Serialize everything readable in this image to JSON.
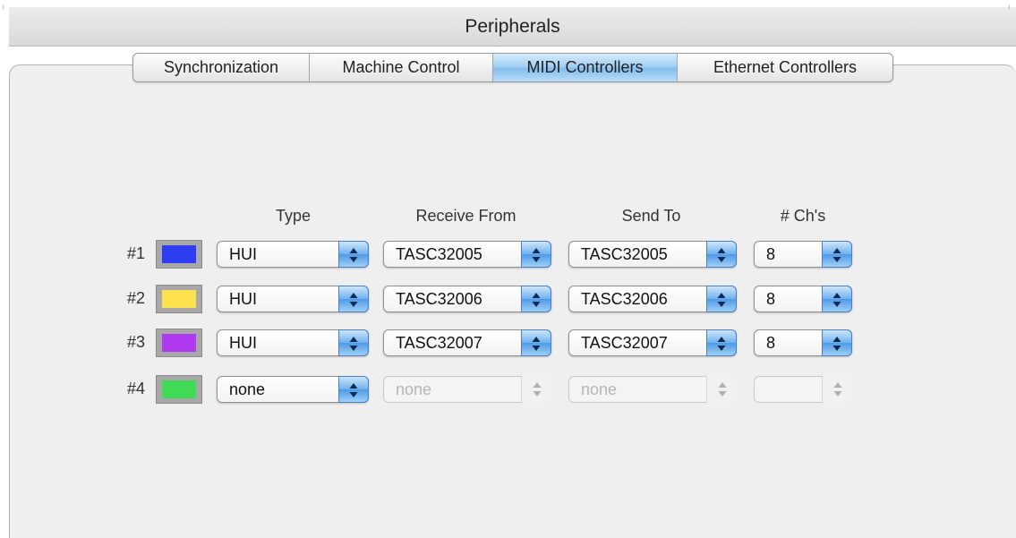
{
  "window": {
    "title": "Peripherals"
  },
  "tabs": [
    {
      "label": "Synchronization",
      "active": false
    },
    {
      "label": "Machine Control",
      "active": false
    },
    {
      "label": "MIDI Controllers",
      "active": true
    },
    {
      "label": "Ethernet Controllers",
      "active": false
    }
  ],
  "columns": {
    "type": "Type",
    "receive_from": "Receive From",
    "send_to": "Send To",
    "channels": "# Ch's"
  },
  "controllers": [
    {
      "label": "#1",
      "color": "#2f3df2",
      "type": "HUI",
      "receive_from": "TASC32005",
      "send_to": "TASC32005",
      "channels": "8",
      "enabled": true
    },
    {
      "label": "#2",
      "color": "#fde24d",
      "type": "HUI",
      "receive_from": "TASC32006",
      "send_to": "TASC32006",
      "channels": "8",
      "enabled": true
    },
    {
      "label": "#3",
      "color": "#b13af0",
      "type": "HUI",
      "receive_from": "TASC32007",
      "send_to": "TASC32007",
      "channels": "8",
      "enabled": true
    },
    {
      "label": "#4",
      "color": "#40db56",
      "type": "none",
      "receive_from": "none",
      "send_to": "none",
      "channels": "",
      "enabled": false
    }
  ]
}
